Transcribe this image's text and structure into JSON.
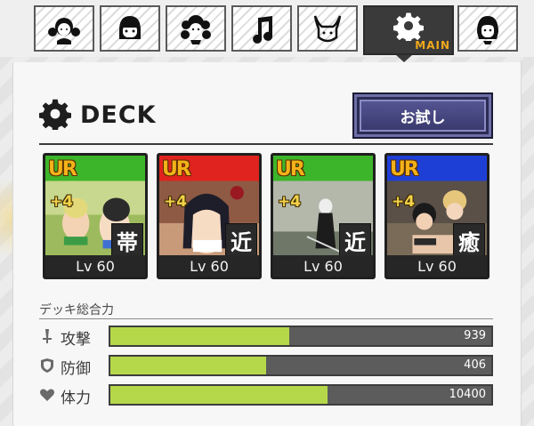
{
  "tabs": [
    {
      "icon": "girl-twin-tails-icon",
      "active": false
    },
    {
      "icon": "girl-bangs-icon",
      "active": false
    },
    {
      "icon": "girl-curly-hair-icon",
      "active": false
    },
    {
      "icon": "music-note-icon",
      "active": false
    },
    {
      "icon": "horned-mask-icon",
      "active": false
    },
    {
      "icon": "gear-icon",
      "active": true,
      "label": "MAIN"
    },
    {
      "icon": "girl-bob-hair-icon",
      "active": false
    }
  ],
  "deck": {
    "title": "DECK",
    "try_button": "お試し"
  },
  "cards": [
    {
      "rarity": "UR",
      "plus": "+4",
      "type": "帯",
      "level": "Lv 60",
      "band_color": "#3db52a"
    },
    {
      "rarity": "UR",
      "plus": "+4",
      "type": "近",
      "level": "Lv 60",
      "band_color": "#e0231e"
    },
    {
      "rarity": "UR",
      "plus": "+4",
      "type": "近",
      "level": "Lv 60",
      "band_color": "#3db52a"
    },
    {
      "rarity": "UR",
      "plus": "+4",
      "type": "癒",
      "level": "Lv 60",
      "band_color": "#1e3fd6"
    }
  ],
  "stats": {
    "title": "デッキ総合力",
    "rows": [
      {
        "icon": "sword-icon",
        "label": "攻撃",
        "value": "939",
        "fill": 0.47
      },
      {
        "icon": "shield-icon",
        "label": "防御",
        "value": "406",
        "fill": 0.41
      },
      {
        "icon": "heart-icon",
        "label": "体力",
        "value": "10400",
        "fill": 0.57
      }
    ]
  },
  "colors": {
    "bar_fill": "#b5d84a",
    "bar_track": "#5c5c5c",
    "button_bg": "#3a3a6e",
    "main_label": "#f0a81b"
  }
}
